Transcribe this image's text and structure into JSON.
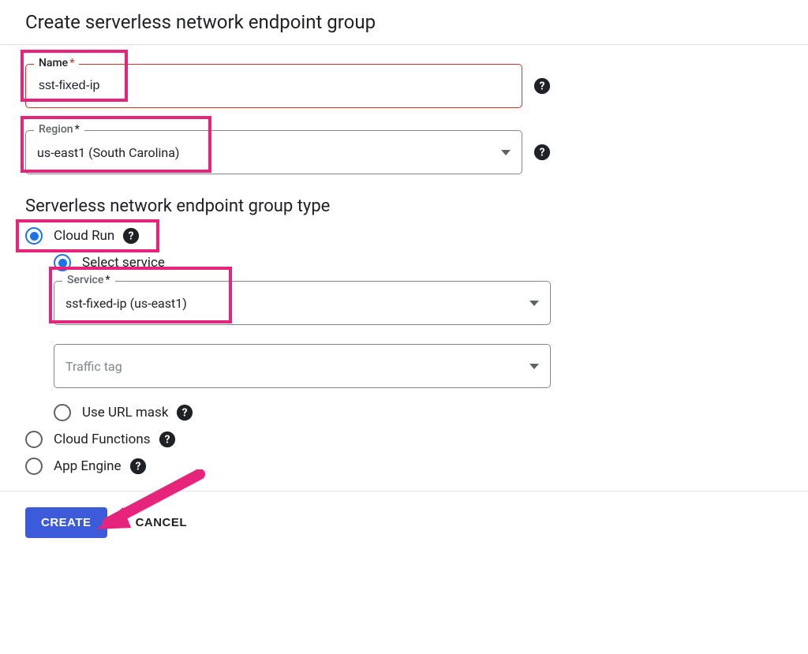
{
  "header": {
    "title": "Create serverless network endpoint group"
  },
  "fields": {
    "name": {
      "label": "Name",
      "value": "sst-fixed-ip",
      "required": true
    },
    "region": {
      "label": "Region",
      "value": "us-east1 (South Carolina)",
      "required": true
    }
  },
  "section": {
    "title": "Serverless network endpoint group type"
  },
  "neg_type": {
    "options": {
      "cloud_run": "Cloud Run",
      "cloud_functions": "Cloud Functions",
      "app_engine": "App Engine"
    },
    "selected": "cloud_run"
  },
  "cloud_run": {
    "modes": {
      "select_service": "Select service",
      "use_url_mask": "Use URL mask"
    },
    "mode_selected": "select_service",
    "service": {
      "label": "Service",
      "value": "sst-fixed-ip (us-east1)",
      "required": true
    },
    "traffic_tag": {
      "label": "Traffic tag",
      "value": ""
    }
  },
  "buttons": {
    "create": "CREATE",
    "cancel": "CANCEL"
  },
  "colors": {
    "accent": "#1a73e8",
    "primary_btn": "#3b5bdb",
    "error": "#d93025",
    "annotation": "#e6247b"
  }
}
